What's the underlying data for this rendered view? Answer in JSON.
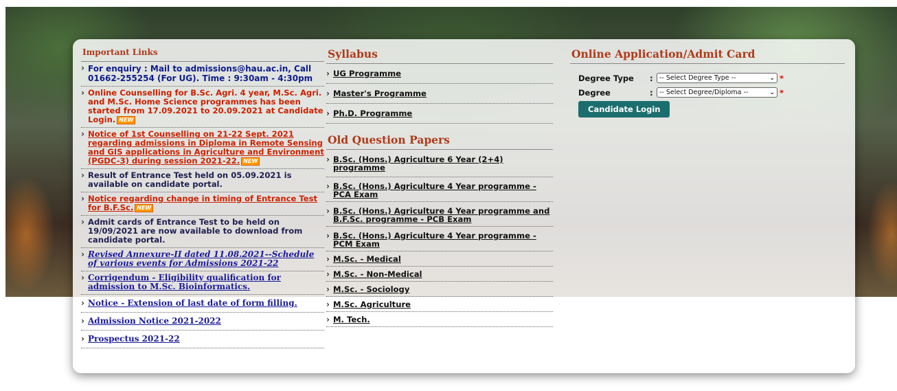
{
  "important_links": {
    "heading": "Important Links",
    "items": [
      {
        "text": "For enquiry : Mail to admissions@hau.ac.in, Call 01662-255254 (For UG). Time : 9:30am - 4:30pm",
        "new": false
      },
      {
        "text": "Online Counselling for B.Sc. Agri. 4 year, M.Sc. Agri. and M.Sc. Home Science programmes has been started from 17.09.2021 to 20.09.2021 at Candidate Login.",
        "new": true
      },
      {
        "text": "Notice of 1st Counselling on 21-22 Sept. 2021 regarding admissions in Diploma in Remote Sensing and GIS applications in Agriculture and Environment (PGDC-3) during session 2021-22.",
        "new": true
      },
      {
        "text": "Result of Entrance Test held on 05.09.2021 is available on candidate portal.",
        "new": false
      },
      {
        "text": "Notice regarding change in timing of Entrance Test for B.F.Sc.",
        "new": true
      },
      {
        "text": "Admit cards of Entrance Test to be held on 19/09/2021 are now available to download from candidate portal.",
        "new": false
      },
      {
        "text": "Revised Annexure-II dated 11.08.2021--Schedule of various events for Admissions 2021-22",
        "new": false
      },
      {
        "text": "Corrigendum - Eligibility qualification for admission to M.Sc. Bioinformatics.",
        "new": false
      },
      {
        "text": "Notice - Extension of last date of form filling.",
        "new": false
      },
      {
        "text": "Admission Notice 2021-2022",
        "new": false
      },
      {
        "text": "Prospectus 2021-22",
        "new": false
      }
    ],
    "new_badge": "NEW"
  },
  "syllabus": {
    "heading": "Syllabus",
    "items": [
      "UG Programme",
      "Master's Programme",
      "Ph.D. Programme"
    ]
  },
  "old_papers": {
    "heading": "Old Question Papers",
    "items": [
      "B.Sc. (Hons.) Agriculture 6 Year (2+4) programme",
      "B.Sc. (Hons.) Agriculture 4 Year programme - PCA Exam",
      "B.Sc. (Hons.) Agriculture 4 Year programme and B.F.Sc. programme - PCB Exam",
      "B.Sc. (Hons.) Agriculture 4 Year programme - PCM Exam",
      "M.Sc. - Medical",
      "M.Sc. - Non-Medical",
      "M.Sc. - Sociology",
      "M.Sc. Agriculture",
      "M. Tech."
    ]
  },
  "application": {
    "heading": "Online Application/Admit Card",
    "degree_type_label": "Degree Type",
    "degree_type_value": "-- Select Degree Type --",
    "degree_label": "Degree",
    "degree_value": "-- Select Degree/Diploma --",
    "colon": ":",
    "required_mark": "*",
    "login_button": "Candidate Login"
  },
  "colors": {
    "heading": "#b03a1a",
    "button": "#1c6e6e",
    "link_blue": "#1a1a9c"
  }
}
